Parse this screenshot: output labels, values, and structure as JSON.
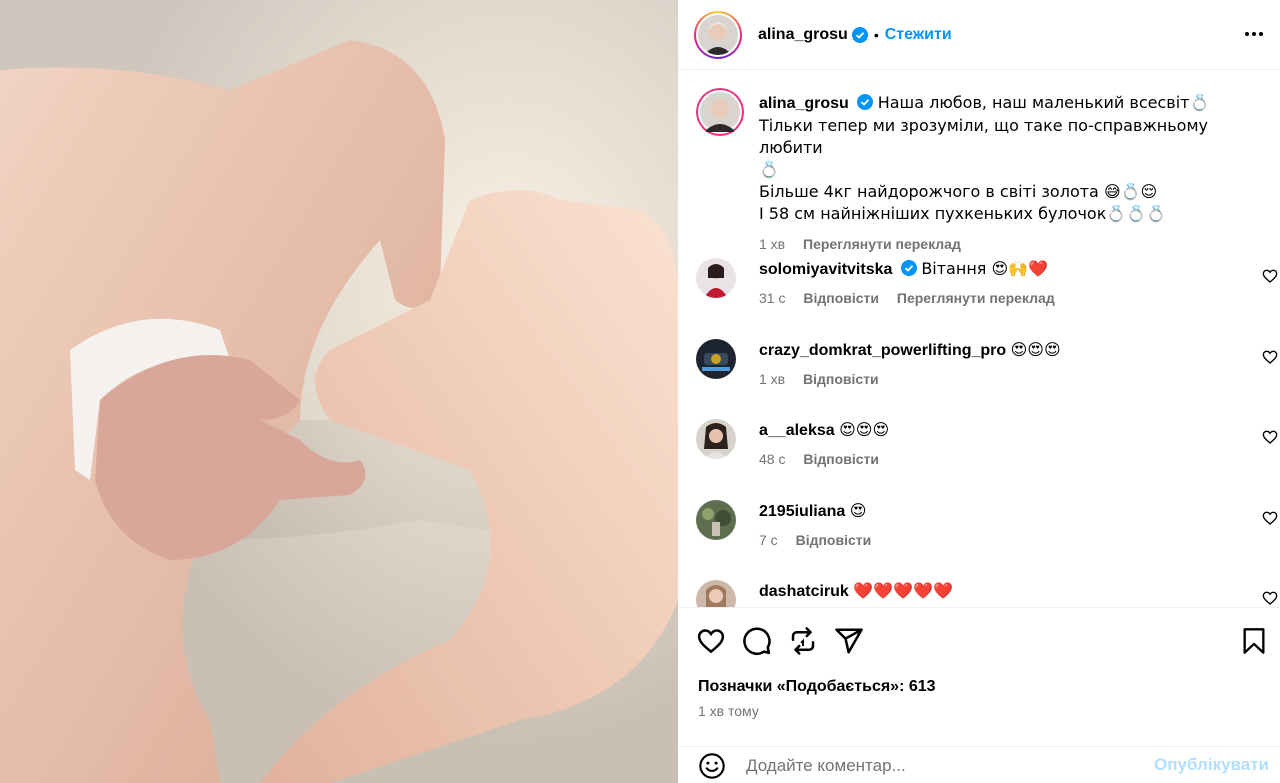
{
  "post": {
    "username": "alina_grosu",
    "separator": "•",
    "follow_label": "Стежити",
    "more_icon": "more-horizontal-icon"
  },
  "caption": {
    "username": "alina_grosu",
    "lines": [
      "Наша любов, наш маленький всесвіт💍",
      "Тільки тепер ми зрозуміли, що таке по-справжньому любити",
      "💍",
      "Більше 4кг найдорожчого в світі золота 😅💍😌",
      "І 58 см найніжніших пухкеньких булочок💍💍💍"
    ],
    "time": "1 хв",
    "translate": "Переглянути переклад"
  },
  "comments": [
    {
      "username": "solomiyavitvitska",
      "verified": true,
      "text": "Вітання 😍🙌❤️",
      "time": "31 с",
      "reply": "Відповісти",
      "translate": "Переглянути переклад"
    },
    {
      "username": "crazy_domkrat_powerlifting_pro",
      "verified": false,
      "text": "😍😍😍",
      "time": "1 хв",
      "reply": "Відповісти"
    },
    {
      "username": "a__aleksa",
      "verified": false,
      "text": "😍😍😍",
      "time": "48 с",
      "reply": "Відповісти"
    },
    {
      "username": "2195iuliana",
      "verified": false,
      "text": "😍",
      "time": "7 с",
      "reply": "Відповісти"
    },
    {
      "username": "dashatciruk",
      "verified": false,
      "text": "❤️❤️❤️❤️❤️",
      "time": "",
      "reply": ""
    }
  ],
  "footer": {
    "likes_text": "Позначки «Подобається»: 613",
    "time_ago": "1 хв тому",
    "comment_placeholder": "Додайте коментар...",
    "publish_label": "Опублікувати"
  },
  "colors": {
    "accent": "#0095f6",
    "muted": "#737373",
    "publish_disabled": "#b2dffc"
  }
}
